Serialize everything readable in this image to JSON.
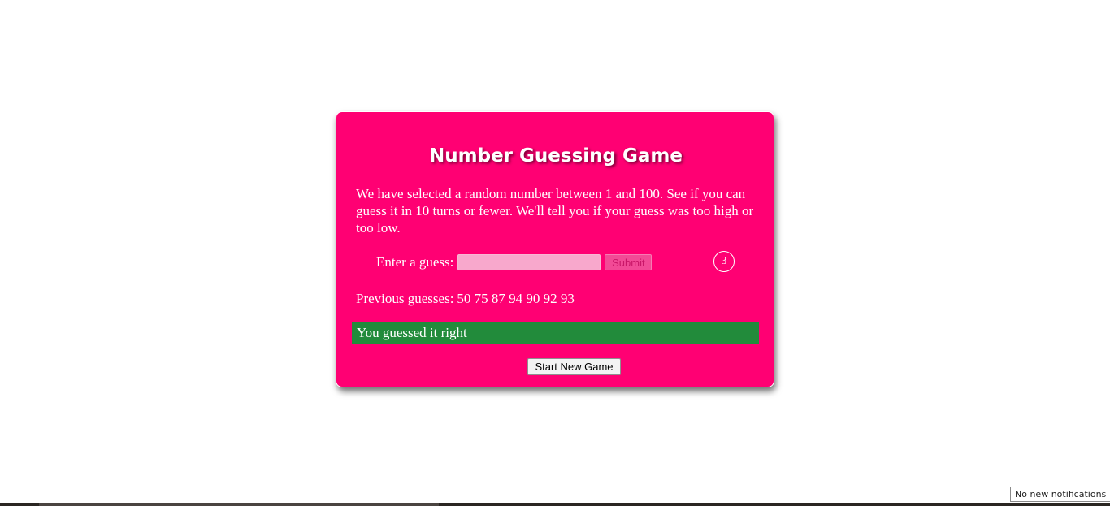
{
  "game": {
    "title": "Number Guessing Game",
    "intro": "We have selected a random number between 1 and 100. See if you can guess it in 10 turns or fewer. We'll tell you if your guess was too high or too low.",
    "guess_label": "Enter a guess:",
    "guess_value": "",
    "guess_placeholder": "",
    "submit_label": "Submit",
    "turn_counter": "3",
    "previous_label": "Previous guesses:",
    "previous_values": "50 75 87 94 90 92 93",
    "result_message": "You guessed it right",
    "new_game_label": "Start New Game"
  },
  "system": {
    "notification_text": "No new notifications"
  },
  "colors": {
    "card_background": "#ff0073",
    "result_background": "#228b3b",
    "text": "#ffffff"
  }
}
